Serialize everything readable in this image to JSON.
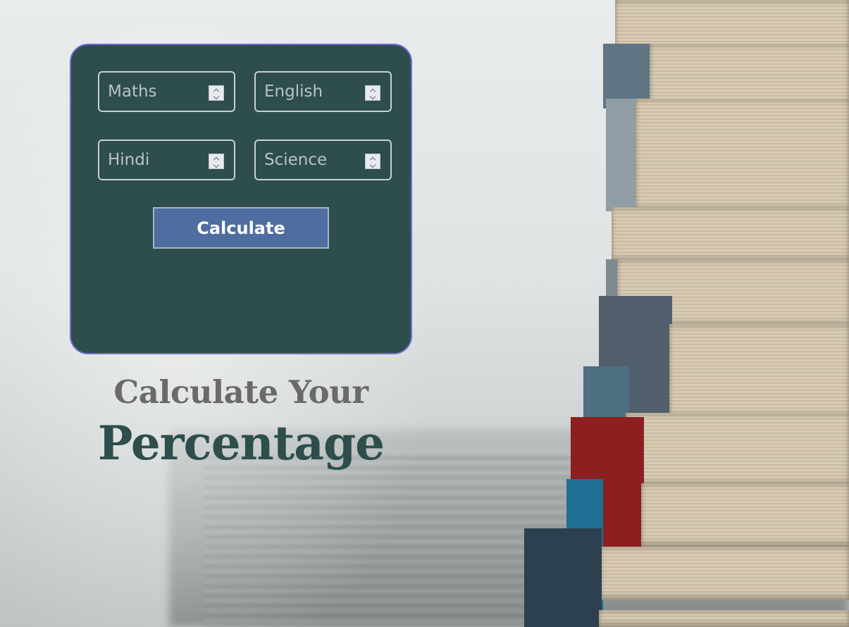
{
  "form": {
    "subjects": [
      {
        "value": "Maths"
      },
      {
        "value": "English"
      },
      {
        "value": "Hindi"
      },
      {
        "value": "Science"
      }
    ],
    "calculate_label": "Calculate"
  },
  "heading": {
    "line1": "Calculate Your",
    "line2": "Percentage"
  },
  "colors": {
    "card_bg": "#2e4d4d",
    "card_border": "#6e6ed6",
    "button_bg": "#4f6da1",
    "heading_dark": "#2e4d4d",
    "heading_grey": "#6a6a6a"
  },
  "icons": {
    "spinner": "up-down-chevron-icon"
  }
}
